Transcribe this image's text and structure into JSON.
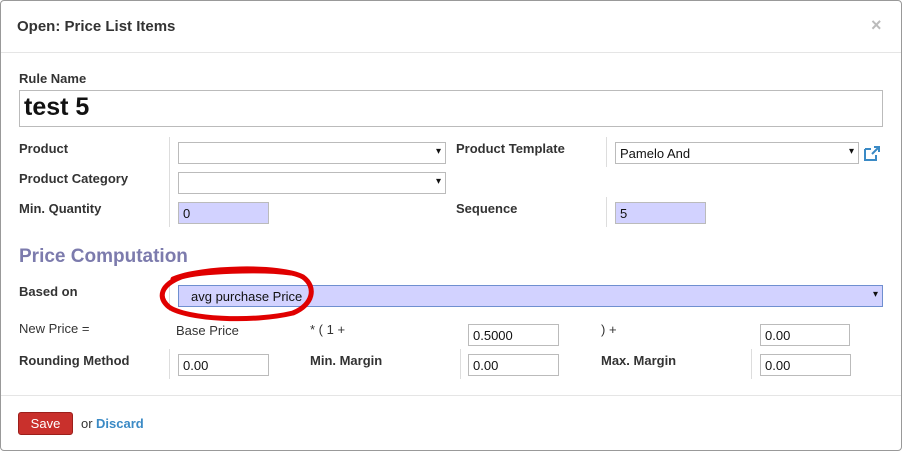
{
  "dialog": {
    "title": "Open: Price List Items",
    "close_glyph": "×"
  },
  "form": {
    "rule_name_label": "Rule Name",
    "rule_name_value": "test 5",
    "product_label": "Product",
    "product_value": "",
    "product_template_label": "Product Template",
    "product_template_value": "Pamelo And",
    "product_category_label": "Product Category",
    "product_category_value": "",
    "min_quantity_label": "Min. Quantity",
    "min_quantity_value": "0",
    "sequence_label": "Sequence",
    "sequence_value": "5"
  },
  "price_computation": {
    "heading": "Price Computation",
    "based_on_label": "Based on",
    "based_on_value": "avg purchase Price",
    "new_price_label": "New Price =",
    "base_price_text": "Base Price",
    "multiply_text": "* ( 1 +",
    "discount_value": "0.5000",
    "plus_text": ") +",
    "surcharge_value": "0.00",
    "rounding_label": "Rounding Method",
    "rounding_value": "0.00",
    "min_margin_label": "Min. Margin",
    "min_margin_value": "0.00",
    "max_margin_label": "Max. Margin",
    "max_margin_value": "0.00"
  },
  "footer": {
    "save_label": "Save",
    "or_text": "or",
    "discard_label": "Discard"
  },
  "icons": {
    "dropdown_arrow": "▾",
    "external_link": "external-link-icon"
  },
  "colors": {
    "required_field": "#d2d2ff",
    "section_heading": "#7c7bad",
    "save_button": "#c9302c",
    "discard_link": "#3b8ac5",
    "annotation_circle": "#e00000"
  }
}
